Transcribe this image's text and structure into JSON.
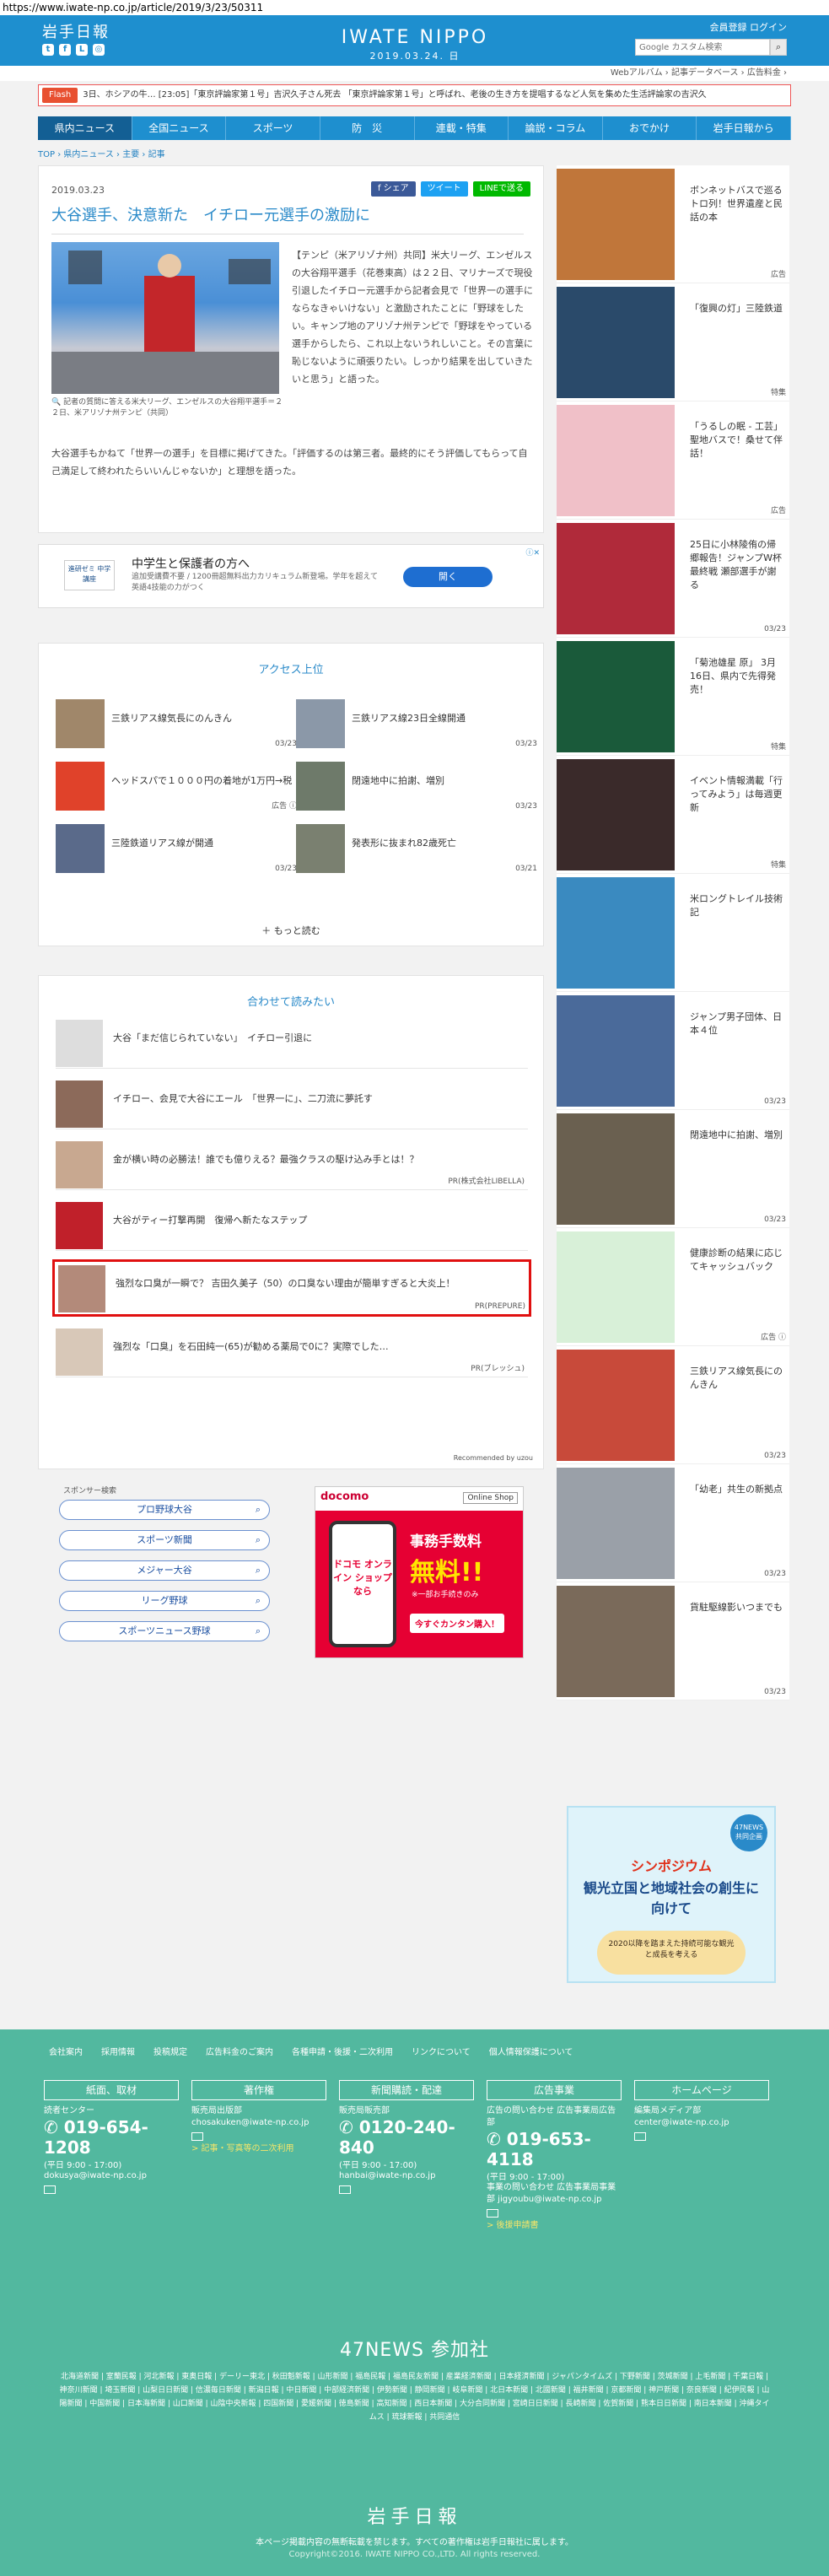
{
  "url": "https://www.iwate-np.co.jp/article/2019/3/23/50311",
  "header": {
    "logo_ja": "岩手日報",
    "logo_en": "IWATE NIPPO",
    "date": "2019.03.24. 日",
    "member": "会員登録  ログイン",
    "search_placeholder": "Google カスタム検索",
    "util": "Webアルバム ›  記事データベース ›  広告料金 ›"
  },
  "ticker": {
    "label": "Flash",
    "text": "3日、ホシアの牛…  [23:05]「東京評論家第１号」吉沢久子さん死去  「東京評論家第１号」と呼ばれ、老後の生き方を提唱するなど人気を集めた生活評論家の吉沢久"
  },
  "nav": [
    "県内ニュース",
    "全国ニュース",
    "スポーツ",
    "防　災",
    "連載・特集",
    "論説・コラム",
    "おでかけ",
    "岩手日報から"
  ],
  "breadcrumb": "TOP › 県内ニュース › 主要 › 記事",
  "article": {
    "date": "2019.03.23",
    "share": [
      "f シェア",
      "ツイート",
      "LINEで送る"
    ],
    "title": "大谷選手、決意新た　イチロー元選手の激励に",
    "caption": "記者の質問に答える米大リーグ、エンゼルスの大谷翔平選手＝２２日、米アリゾナ州テンピ（共同）",
    "body1": "【テンピ（米アリゾナ州）共同】米大リーグ、エンゼルスの大谷翔平選手（花巻東高）は２２日、マリナーズで現役引退したイチロー元選手から記者会見で「世界一の選手にならなきゃいけない」と激励されたことに「野球をしたい。キャンプ地のアリゾナ州テンピで「野球をやっている選手からしたら、これ以上ないうれしいこと。その言葉に恥じないように頑張りたい。しっかり結果を出していきたいと思う」と語った。",
    "body2": "大谷選手もかねて「世界一の選手」を目標に掲げてきた。「評価するのは第三者。最終的にそう評価してもらって自己満足して終われたらいいんじゃないか」と理想を語った。"
  },
  "ad": {
    "thumb": "進研ゼミ 中学講座",
    "title": "中学生と保護者の方へ",
    "desc": "追加受講費不要 / 1200冊超無料出力カリキュラム新登場。学年を超えて英語4技能の力がつく",
    "button": "開く"
  },
  "ranking": {
    "title": "アクセス上位",
    "items": [
      {
        "text": "三鉄リアス線気長にのんきん",
        "date": "03/23"
      },
      {
        "text": "三鉄リアス線23日全線開通",
        "date": "03/23"
      },
      {
        "text": "ヘッドスパで１０００円の着地が1万円→税",
        "date": "広告 ⓘ"
      },
      {
        "text": "閉遠地中に拍謝、増別",
        "date": "03/23"
      },
      {
        "text": "三陸鉄道リアス線が開通",
        "date": "03/23"
      },
      {
        "text": "発表形に抜まれ82歳死亡",
        "date": "03/21"
      }
    ],
    "more": "＋ もっと読む"
  },
  "related": {
    "title": "合わせて読みたい",
    "items": [
      {
        "text": "大谷「まだ信じられていない」　イチロー引退に",
        "pr": ""
      },
      {
        "text": "イチロー、会見で大谷にエール　「世界一に」、二刀流に夢託す",
        "pr": ""
      },
      {
        "text": "金が横い時の必勝法！誰でも億りえる？最強クラスの駆け込み手とは！？",
        "pr": "PR(株式会社LIBELLA)"
      },
      {
        "text": "大谷がティー打撃再開　復帰へ新たなステップ",
        "pr": ""
      },
      {
        "text": "強烈な口臭が一瞬で？ 吉田久美子（50）の口臭ない理由が簡単すぎると大炎上！",
        "pr": "PR(PREPURE)"
      },
      {
        "text": "強烈な「口臭」を石田純一(65)が勧める薬局で0に？実際でした…",
        "pr": "PR(ブレッシュ)"
      }
    ],
    "recommended": "Recommended by  uzou"
  },
  "sponsor": {
    "heading": "スポンサー検索",
    "items": [
      "プロ野球大谷",
      "スポーツ新聞",
      "メジャー大谷",
      "リーグ野球",
      "スポーツニュース野球"
    ]
  },
  "docomo": {
    "brand": "docomo",
    "shop": "Online Shop",
    "phone": "ドコモ オンライン ショップ なら",
    "fee_title": "事務手数料",
    "fee": "無料!!",
    "note": "※一部お手続きのみ",
    "buy": "今すぐカンタン購入！"
  },
  "sidebar": [
    {
      "text": "ボンネットバスで巡るトロ列！世界遺産と民話の本",
      "label": "広告"
    },
    {
      "text": "「復興の灯」三陸鉄道",
      "label": "特集"
    },
    {
      "text": "「うるしの眠 - 工芸」聖地バスで！桑せて伴話！",
      "label": "広告"
    },
    {
      "text": "25日に小林陵侑の帰郷報告！ジャンプW杯最終戦 瀬部選手が謝る",
      "label": "03/23"
    },
    {
      "text": "「菊池雄星 原」 3月16日、県内で先得発売！",
      "label": "特集"
    },
    {
      "text": "イベント情報満載「行ってみよう」は毎週更新",
      "label": "特集"
    },
    {
      "text": "米ロングトレイル技術記",
      "label": ""
    },
    {
      "text": "ジャンプ男子団体、日本４位",
      "label": "03/23"
    },
    {
      "text": "閉遠地中に拍謝、増別",
      "label": "03/23"
    },
    {
      "text": "健康診断の結果に応じてキャッシュバック",
      "label": "広告 ⓘ"
    },
    {
      "text": "三鉄リアス線気長にのんきん",
      "label": "03/23"
    },
    {
      "text": "「幼老」共生の新拠点",
      "label": "03/23"
    },
    {
      "text": "貨駐駆線影いつまでも",
      "label": "03/23"
    }
  ],
  "side_banner": {
    "tag": "47NEWS 共同企画",
    "title": "シンポジウム",
    "main": "観光立国と地域社会の創生に向けて",
    "sub": "2020以降を踏まえた持続可能な観光と成長を考える"
  },
  "footer": {
    "links": [
      "会社案内",
      "採用情報",
      "投稿規定",
      "広告料金のご案内",
      "各種申請・後援・二次利用",
      "リンクについて",
      "個人情報保護について"
    ],
    "columns": [
      {
        "head": "紙面、取材",
        "name": "読者センター",
        "phone": "019-654-1208",
        "hours": "(平日 9:00 - 17:00)",
        "mail": "dokusya@iwate-np.co.jp",
        "extra": ""
      },
      {
        "head": "著作権",
        "name": "販売局出版部",
        "phone": "",
        "hours": "",
        "mail": "chosakuken@iwate-np.co.jp",
        "extra": "> 記事・写真等の二次利用"
      },
      {
        "head": "新聞購読・配達",
        "name": "販売局販売部",
        "phone": "0120-240-840",
        "hours": "(平日 9:00 - 17:00)",
        "mail": "hanbai@iwate-np.co.jp",
        "extra": ""
      },
      {
        "head": "広告事業",
        "name": "広告の問い合わせ 広告事業局広告部",
        "phone": "019-653-4118",
        "hours": "(平日 9:00 - 17:00)",
        "mail": "事業の問い合わせ 広告事業局事業部 jigyoubu@iwate-np.co.jp",
        "extra": "> 後援申請書"
      },
      {
        "head": "ホームページ",
        "name": "編集局メディア部",
        "phone": "",
        "hours": "",
        "mail": "center@iwate-np.co.jp",
        "extra": ""
      }
    ],
    "n47": "47NEWS 参加社",
    "papers": "北海道新聞 | 室蘭民報 | 河北新報 | 東奥日報 | デーリー東北 | 秋田魁新報 | 山形新聞 | 福島民報 | 福島民友新聞 | 産業経済新聞 | 日本経済新聞 | ジャパンタイムズ | 下野新聞 | 茨城新聞 | 上毛新聞 | 千葉日報 | 神奈川新聞 | 埼玉新聞 | 山梨日日新聞 | 信濃毎日新聞 | 新潟日報 | 中日新聞 | 中部経済新聞 | 伊勢新聞 | 静岡新聞 | 岐阜新聞 | 北日本新聞 | 北國新聞 | 福井新聞 | 京都新聞 | 神戸新聞 | 奈良新聞 | 紀伊民報 | 山陽新聞 | 中国新聞 | 日本海新聞 | 山口新聞 | 山陰中央新報 | 四国新聞 | 愛媛新聞 | 徳島新聞 | 高知新聞 | 西日本新聞 | 大分合同新聞 | 宮崎日日新聞 | 長崎新聞 | 佐賀新聞 | 熊本日日新聞 | 南日本新聞 | 沖縄タイムス | 琉球新報 | 共同通信",
    "logo": "岩手日報",
    "notice": "本ページ掲載内容の無断転載を禁じます。すべての著作権は岩手日報社に属します。",
    "copyright": "Copyright©2016. IWATE NIPPO CO.,LTD. All rights reserved."
  }
}
